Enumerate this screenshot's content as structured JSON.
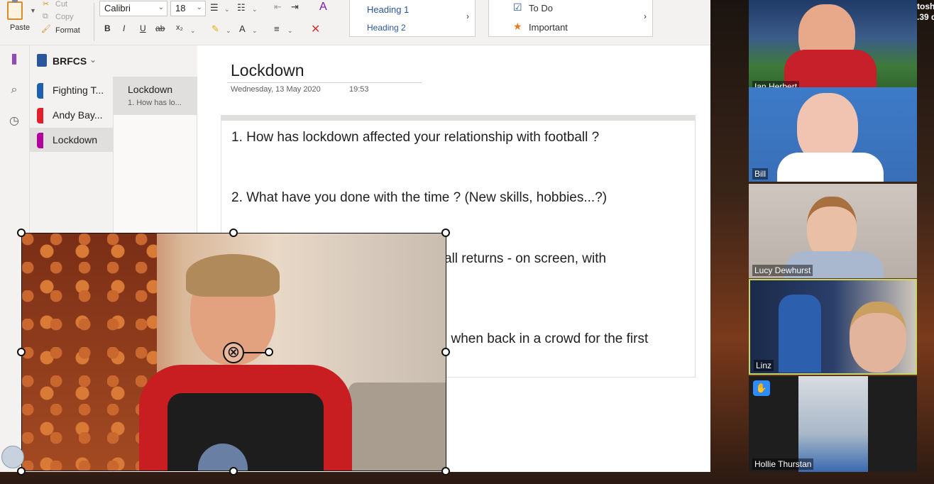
{
  "ribbon": {
    "paste_label": "Paste",
    "cut_label": "Cut",
    "copy_label": "Copy",
    "format_label": "Format",
    "font_name": "Calibri",
    "font_size": "18",
    "bold_glyph": "B",
    "italic_glyph": "I",
    "underline_glyph": "U",
    "strike_glyph": "ab",
    "subscript_glyph": "x₂",
    "font_color_glyph": "A",
    "styles": {
      "heading1": "Heading 1",
      "heading2": "Heading 2"
    },
    "tags": {
      "todo": "To Do",
      "important": "Important"
    }
  },
  "notebook": {
    "name": "BRFCS",
    "sections": [
      {
        "label": "Fighting T...",
        "color": "#1f5fad"
      },
      {
        "label": "Andy Bay...",
        "color": "#e3202a"
      },
      {
        "label": "Lockdown",
        "color": "#b4009e"
      }
    ],
    "pages": [
      {
        "title": "Lockdown",
        "snippet": "1. How has lo..."
      }
    ]
  },
  "note": {
    "title": "Lockdown",
    "date": "Wednesday, 13 May 2020",
    "time": "19:53",
    "q1": "1. How has lockdown affected your relationship with football ?",
    "q2": "2. What have you done with the time ? (New skills, hobbies...?)",
    "q3_visible": "all returns - on screen, with",
    "q4_visible": "l when back in a crowd for the first"
  },
  "gallery": {
    "participants": [
      {
        "name": "Ian Herbert"
      },
      {
        "name": "Bill"
      },
      {
        "name": "Lucy Dewhurst"
      },
      {
        "name": "Linz"
      },
      {
        "name": "Hollie Thurstan"
      }
    ],
    "corner_text_1": "tosh",
    "corner_text_2": ".39 d"
  },
  "colors": {
    "active_speaker_border": "#c5d96b",
    "raise_hand": "#2d8cff",
    "onenote_purple": "#7719aa"
  }
}
